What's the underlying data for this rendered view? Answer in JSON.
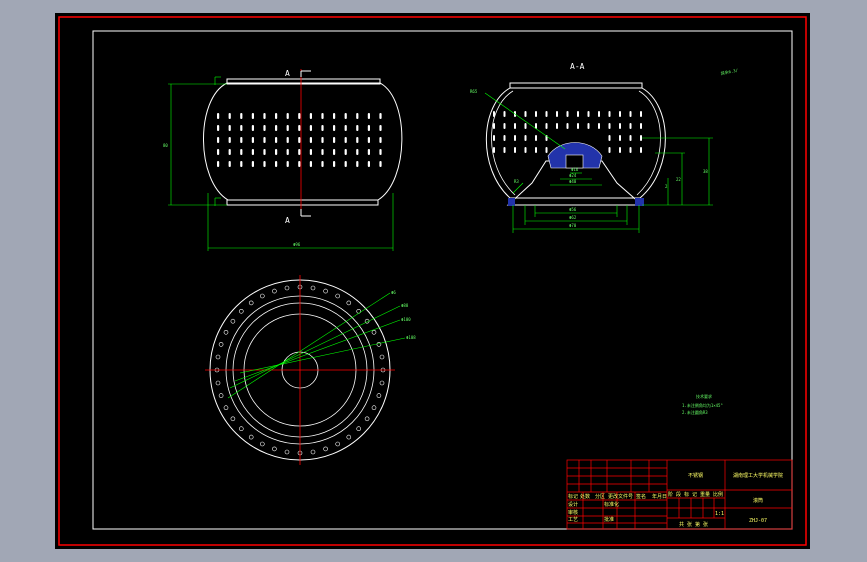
{
  "drawing": {
    "section_marker_top": "A",
    "section_marker_bottom": "A",
    "section_title": "A-A",
    "roughness_note": "其余6.3/",
    "tech_requirements": {
      "title": "技术要求",
      "lines": [
        "1.未注倒角均为1×45°",
        "2.未注圆角R3"
      ]
    },
    "dims": {
      "front_width": "Φ96",
      "front_height": "80",
      "sec_h1": "38",
      "sec_h2": "22",
      "sec_w1": "Φ16",
      "sec_w2": "Φ24",
      "sec_w3": "Φ40",
      "sec_w4": "Φ56",
      "sec_w5": "Φ62",
      "sec_w6": "Φ70",
      "leader1": "R65",
      "leader2": "2",
      "leader3": "R3",
      "plan_d1": "Φ6",
      "plan_d2": "Φ88",
      "plan_d3": "Φ100",
      "plan_d4": "Φ108"
    }
  },
  "title_block": {
    "material": "不锈钢",
    "school": "湖南理工大学机械学院",
    "drawing_name": "滚筒",
    "drawing_no": "ZHJ-07",
    "scale_row": "阶 段 标 记  重量  比例",
    "scale": "1:1",
    "sheet_info": "共 张 第 张",
    "header_labels": [
      "标记",
      "处数",
      "分区",
      "更改文件号",
      "签名",
      "年月日"
    ],
    "role_labels": [
      "设计",
      "审核",
      "工艺",
      "标准化",
      "批准"
    ]
  },
  "colors": {
    "sheet": "#000000",
    "border": "#ff0000",
    "frame": "#ffffff",
    "dimension": "#00ff00",
    "center": "#ff0000",
    "hatch": "#2233aa",
    "text": "#ffff66"
  }
}
